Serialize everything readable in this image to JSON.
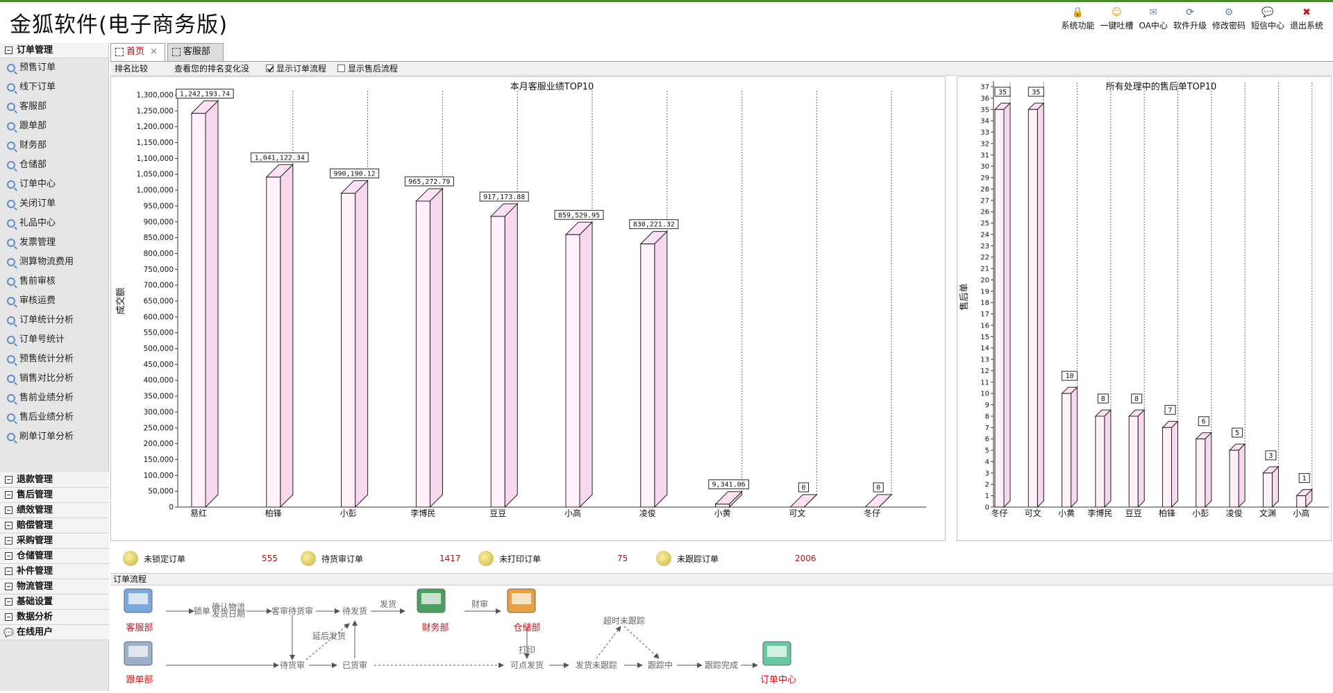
{
  "app_title": "金狐软件(电子商务版)",
  "toolbar": [
    {
      "label": "系统功能",
      "icon": "lock-icon",
      "glyph": "🔒"
    },
    {
      "label": "一键吐槽",
      "icon": "smiley-icon",
      "glyph": "☺"
    },
    {
      "label": "OA中心",
      "icon": "mail-icon",
      "glyph": "✉"
    },
    {
      "label": "软件升级",
      "icon": "upgrade-icon",
      "glyph": "⟳"
    },
    {
      "label": "修改密码",
      "icon": "gear-icon",
      "glyph": "⚙"
    },
    {
      "label": "短信中心",
      "icon": "chat-icon",
      "glyph": "💬"
    },
    {
      "label": "退出系统",
      "icon": "close-icon",
      "glyph": "✖"
    }
  ],
  "sidebar": {
    "top_group": "订单管理",
    "items": [
      "预售订单",
      "线下订单",
      "客服部",
      "跟单部",
      "财务部",
      "仓储部",
      "订单中心",
      "关闭订单",
      "礼品中心",
      "发票管理",
      "测算物流费用",
      "售前审核",
      "审核运费",
      "订单统计分析",
      "订单号统计",
      "预售统计分析",
      "销售对比分析",
      "售前业绩分析",
      "售后业绩分析",
      "刷单订单分析"
    ],
    "groups": [
      "退款管理",
      "售后管理",
      "绩效管理",
      "赔偿管理",
      "采购管理",
      "仓储管理",
      "补件管理",
      "物流管理",
      "基础设置",
      "数据分析"
    ],
    "online": "在线用户"
  },
  "tabs": [
    {
      "label": "首页",
      "active": true,
      "closable": true
    },
    {
      "label": "客服部",
      "active": false
    }
  ],
  "optbar": {
    "rank": "排名比较",
    "rank_note": "查看您的排名变化没",
    "opt1": "显示订单流程",
    "opt1_checked": true,
    "opt2": "显示售后流程",
    "opt2_checked": false
  },
  "chart_data": [
    {
      "type": "bar",
      "title": "本月客服业绩TOP10",
      "ylabel": "成交额",
      "ylim": [
        0,
        1300000
      ],
      "ytick_step": 50000,
      "categories": [
        "易红",
        "柏锋",
        "小彭",
        "李博民",
        "豆豆",
        "小高",
        "凌俊",
        "小黄",
        "可文",
        "冬仔"
      ],
      "values": [
        1242193.74,
        1041122.34,
        990190.12,
        965272.79,
        917173.88,
        859529.95,
        830221.32,
        9341.06,
        0,
        0
      ],
      "labels": [
        "1,242,193.74",
        "1,041,122.34",
        "990,190.12",
        "965,272.79",
        "917,173.88",
        "859,529.95",
        "830,221.32",
        "9,341.06",
        "0",
        "0"
      ]
    },
    {
      "type": "bar",
      "title": "所有处理中的售后单TOP10",
      "ylabel": "售后单",
      "ylim": [
        0,
        37
      ],
      "ytick_step": 1,
      "categories": [
        "冬仔",
        "可文",
        "小黄",
        "李博民",
        "豆豆",
        "柏锋",
        "小彭",
        "凌俊",
        "文渊",
        "小高"
      ],
      "values": [
        35,
        35,
        10,
        8,
        8,
        7,
        6,
        5,
        3,
        1
      ],
      "labels": [
        "35",
        "35",
        "10",
        "8",
        "8",
        "7",
        "6",
        "5",
        "3",
        "1"
      ]
    }
  ],
  "counts": [
    {
      "label": "未锁定订单",
      "value": "555"
    },
    {
      "label": "待货审订单",
      "value": "1417"
    },
    {
      "label": "未打印订单",
      "value": "75"
    },
    {
      "label": "未跟踪订单",
      "value": "2006"
    }
  ],
  "flow": {
    "title": "订单流程",
    "departments": {
      "kefu": "客服部",
      "gendan": "跟单部",
      "caiwu": "财务部",
      "cangchu": "仓储部",
      "center": "订单中心"
    },
    "steps": {
      "lock": "锁单",
      "confirm": "确认物流",
      "date": "发货日期",
      "review": "客审待货审",
      "wait_ship": "待发货",
      "ship": "发货",
      "finance": "财审",
      "delay": "延后发货",
      "wait_goods": "待货审",
      "goods_ok": "已货审",
      "print": "打印",
      "can_ship": "可点发货",
      "not_tracked": "发货未跟踪",
      "tracking": "跟踪中",
      "done": "跟踪完成",
      "overdue": "超时未跟踪"
    }
  },
  "colors": {
    "bar_face": "#fff0fa",
    "bar_top": "#ffe0f4",
    "count_value": "#a01818",
    "dept": "#d01010"
  }
}
